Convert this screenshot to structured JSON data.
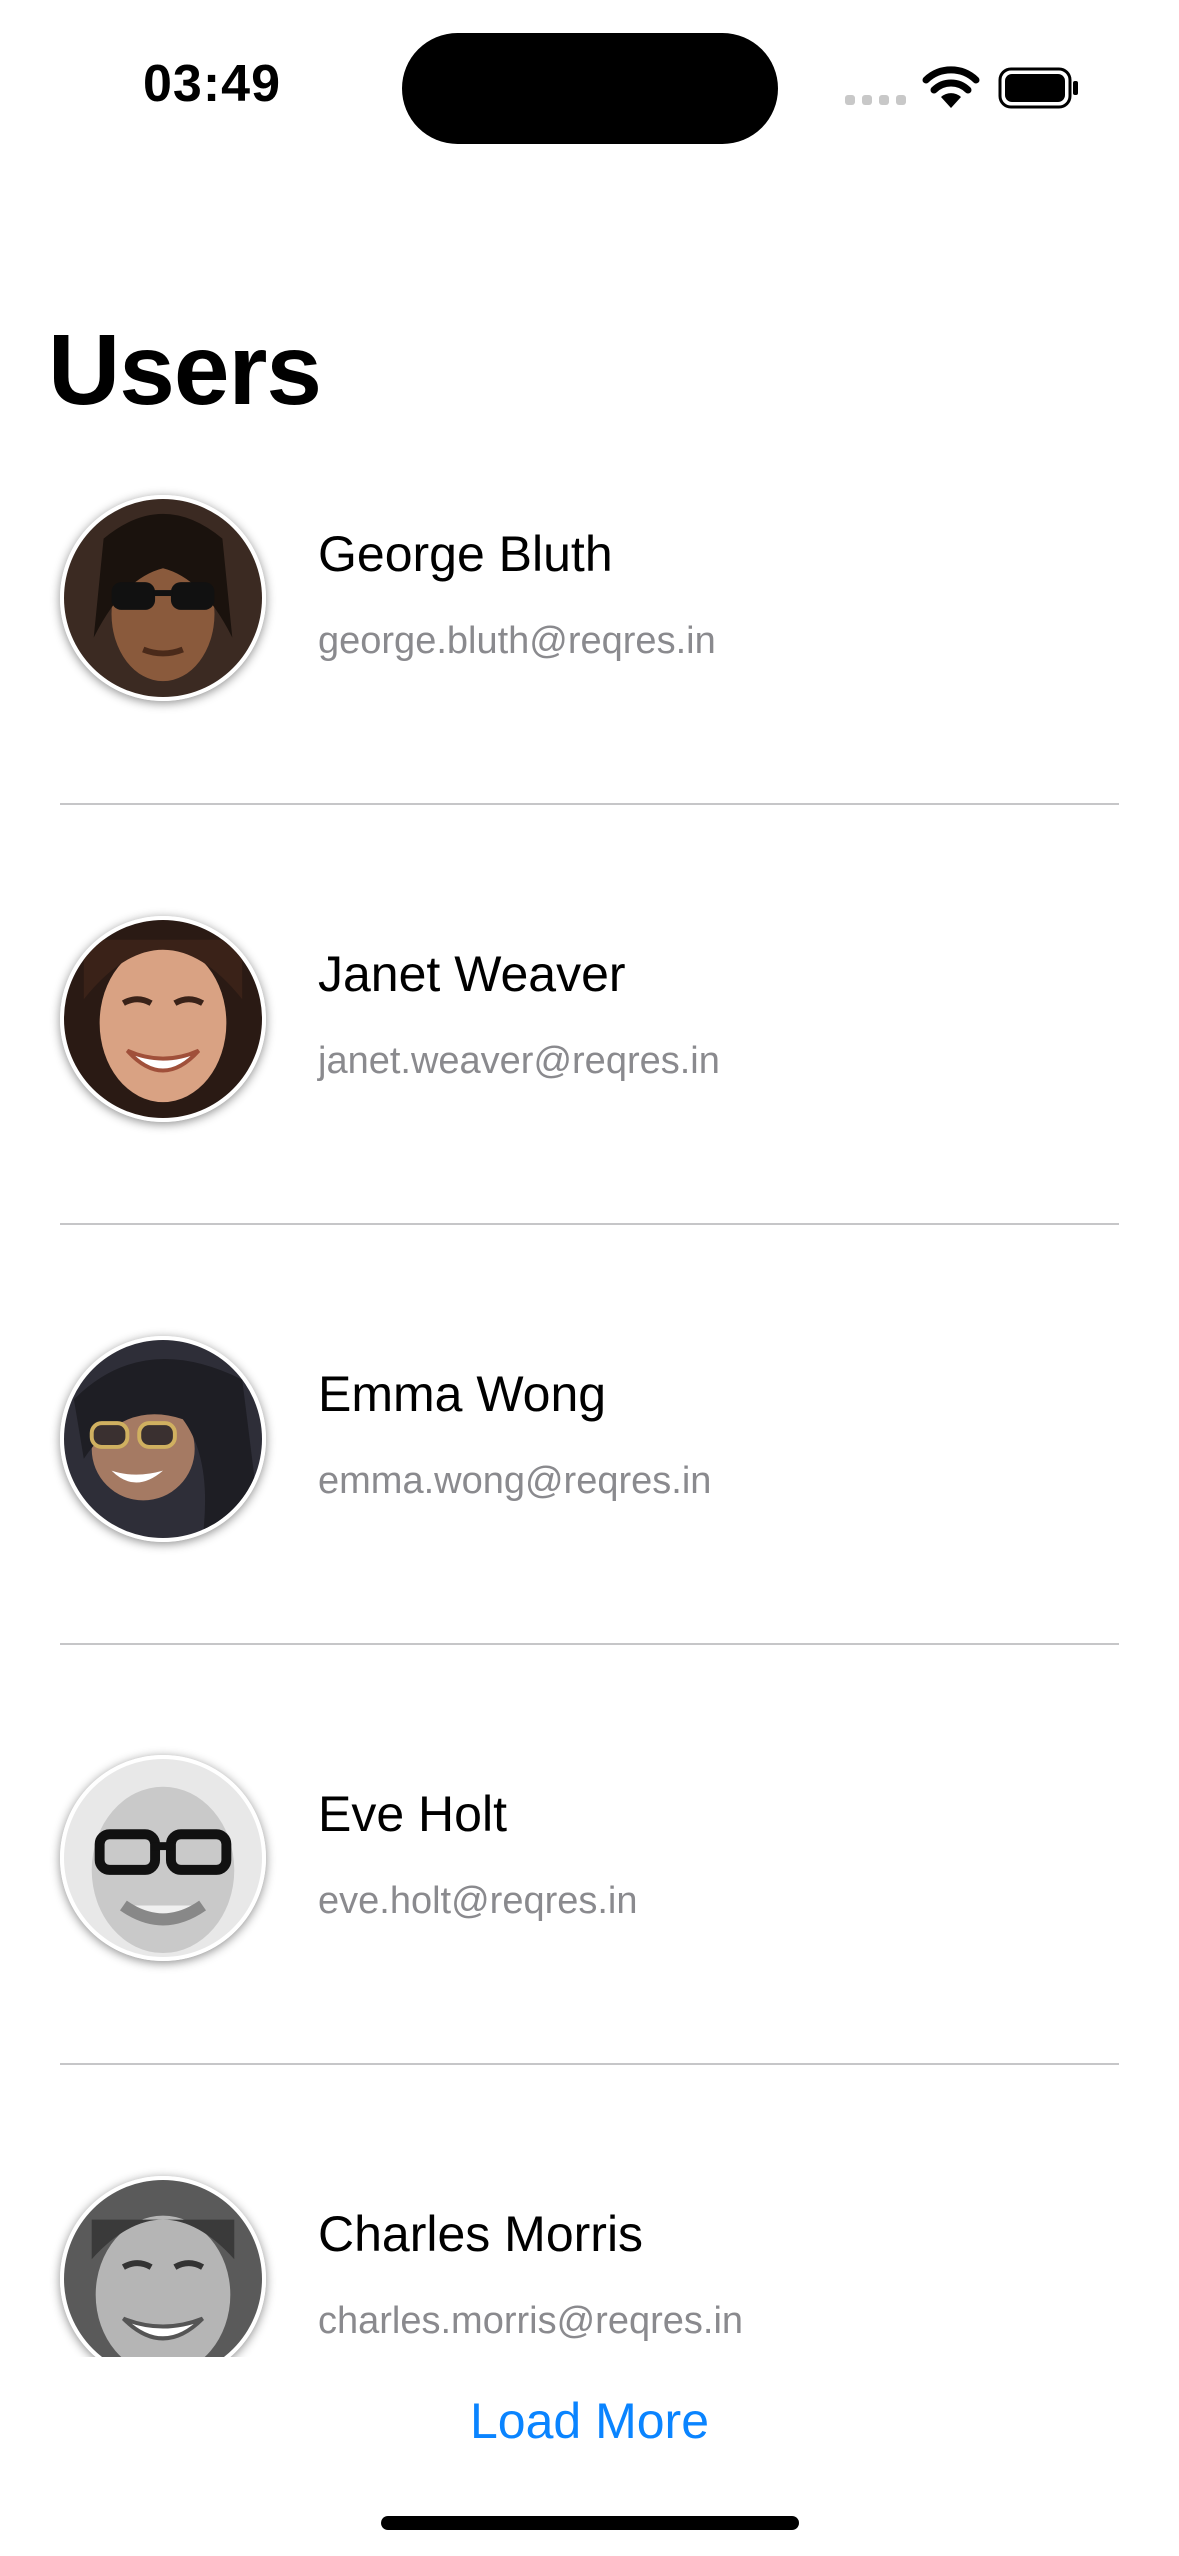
{
  "status_bar": {
    "time": "03:49",
    "icons": [
      "cellular-signal-icon",
      "wifi-icon",
      "battery-icon"
    ]
  },
  "page": {
    "title": "Users"
  },
  "users": [
    {
      "name": "George Bluth",
      "email": "george.bluth@reqres.in",
      "avatar_icon": "avatar-photo"
    },
    {
      "name": "Janet Weaver",
      "email": "janet.weaver@reqres.in",
      "avatar_icon": "avatar-photo"
    },
    {
      "name": "Emma Wong",
      "email": "emma.wong@reqres.in",
      "avatar_icon": "avatar-photo"
    },
    {
      "name": "Eve Holt",
      "email": "eve.holt@reqres.in",
      "avatar_icon": "avatar-photo"
    },
    {
      "name": "Charles Morris",
      "email": "charles.morris@reqres.in",
      "avatar_icon": "avatar-photo"
    }
  ],
  "load_more_label": "Load More",
  "colors": {
    "accent": "#0a84ff",
    "secondary_text": "#8a8a8e",
    "divider": "#c6c6c8"
  }
}
